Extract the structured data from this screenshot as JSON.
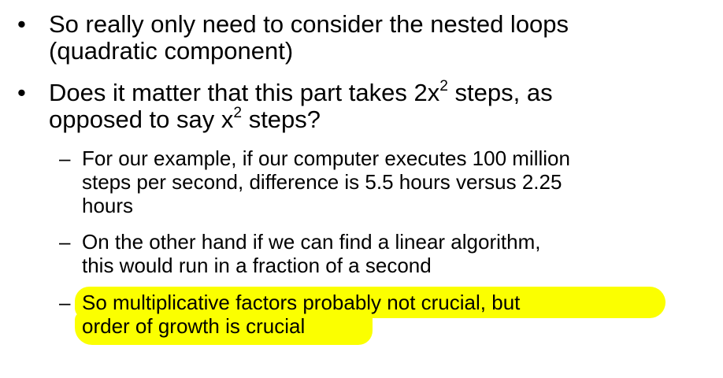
{
  "bullets": [
    {
      "marker": "•",
      "line1": "So really only need to consider the nested loops",
      "line2": "(quadratic component)"
    },
    {
      "marker": "•",
      "line1_pre": "Does it matter that this part takes 2x",
      "line1_sup": "2",
      "line1_post": " steps, as",
      "line2_pre": "opposed to say x",
      "line2_sup": "2",
      "line2_post": " steps?"
    }
  ],
  "sub_bullets": [
    {
      "marker": "–",
      "line1": "For our example, if our computer executes 100 million",
      "line2": "steps per second, difference is 5.5 hours versus 2.25",
      "line3": "hours"
    },
    {
      "marker": "–",
      "line1": "On the other hand if we can find a linear algorithm,",
      "line2": "this would run in a fraction of a second"
    },
    {
      "marker": "–",
      "line1": "So multiplicative factors probably not crucial, but",
      "line2": "order of growth is crucial",
      "highlight_color": "#fbff00"
    }
  ]
}
